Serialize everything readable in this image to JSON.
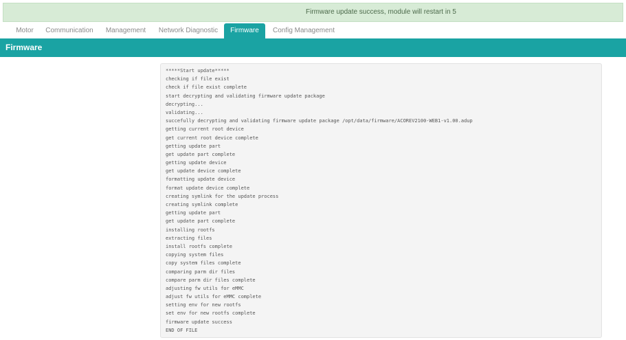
{
  "banner": {
    "message": "Firmware update success, module will restart in 5"
  },
  "tabs": [
    {
      "label": "Motor"
    },
    {
      "label": "Communication"
    },
    {
      "label": "Management"
    },
    {
      "label": "Network Diagnostic"
    },
    {
      "label": "Firmware",
      "active": true
    },
    {
      "label": "Config Management"
    }
  ],
  "section": {
    "title": "Firmware"
  },
  "log": {
    "lines": [
      "*****Start update*****",
      "checking if file exist",
      "check if file exist complete",
      "start decrypting and validating firmware update package",
      "decrypting...",
      "validating...",
      "succefully decrypting and validating firmware update package /opt/data/firmware/ACOREV2100-WEB1-v1.00.adup",
      "getting current root device",
      "get current root device complete",
      "getting update part",
      "get update part complete",
      "getting update device",
      "get update device complete",
      "formatting update device",
      "format update device complete",
      "creating symlink for the update process",
      "creating symlink complete",
      "getting update part",
      "get update part complete",
      "installing rootfs",
      "extracting files",
      "install rootfs complete",
      "copying system files",
      "copy system files complete",
      "comparing parm dir files",
      "compare parm dir files complete",
      "adjusting fw utils for eMMC",
      "adjust fw utils for eMMC complete",
      "setting env for new rootfs",
      "set env for new rootfs complete",
      "firmware update success",
      "END OF FILE"
    ]
  },
  "colors": {
    "accent": "#1aa3a3",
    "banner_bg": "#d7ebd6",
    "banner_text": "#4d6b4c"
  }
}
